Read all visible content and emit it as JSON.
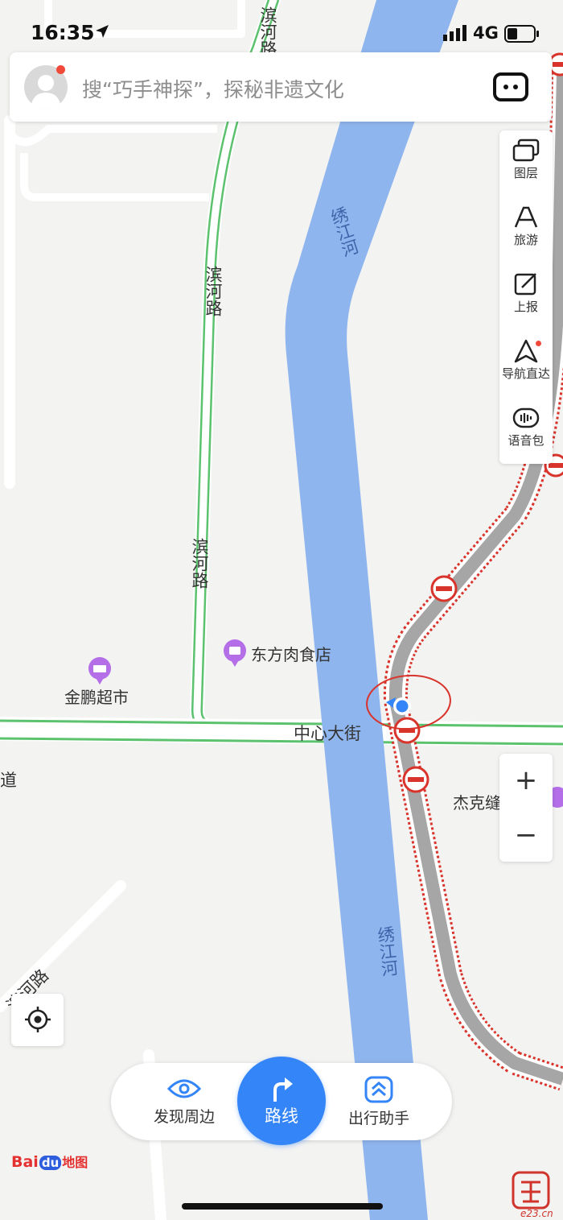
{
  "status_bar": {
    "time": "16:35",
    "network": "4G"
  },
  "search": {
    "placeholder": "搜“巧手神探”，探秘非遗文化"
  },
  "toolbar": {
    "items": [
      {
        "label": "图层",
        "icon": "layers-icon"
      },
      {
        "label": "旅游",
        "icon": "travel-icon"
      },
      {
        "label": "上报",
        "icon": "report-icon"
      },
      {
        "label": "导航直达",
        "icon": "navigation-icon"
      },
      {
        "label": "语音包",
        "icon": "voice-pack-icon"
      }
    ]
  },
  "zoom": {
    "in": "+",
    "out": "−"
  },
  "map": {
    "roads": {
      "binhe_top": "滨河路",
      "binhe_mid": "滨河路",
      "binhe_low": "滨河路",
      "binhe_sw": "滨河路",
      "zhongxin": "中心大街",
      "dao": "道"
    },
    "river": {
      "north": "绣江河",
      "south": "绣江河"
    },
    "pois": [
      {
        "name": "东方肉食店",
        "category": "shop"
      },
      {
        "name": "金鹏超市",
        "category": "supermarket"
      },
      {
        "name": "杰克缝",
        "category": "shop"
      }
    ]
  },
  "bottom_bar": {
    "discover": "发现周边",
    "route": "路线",
    "assistant": "出行助手"
  },
  "footer": {
    "logo_bai": "Bai",
    "logo_du": "du",
    "logo_map": "地图",
    "watermark_domain": "e23.cn"
  },
  "colors": {
    "river": "#8fb5ee",
    "road_green": "#5cc26e",
    "closed_road": "#a6a6a6",
    "closed_dash": "#d9342b",
    "accent": "#3485f7",
    "marker_circle": "#d9342b"
  }
}
